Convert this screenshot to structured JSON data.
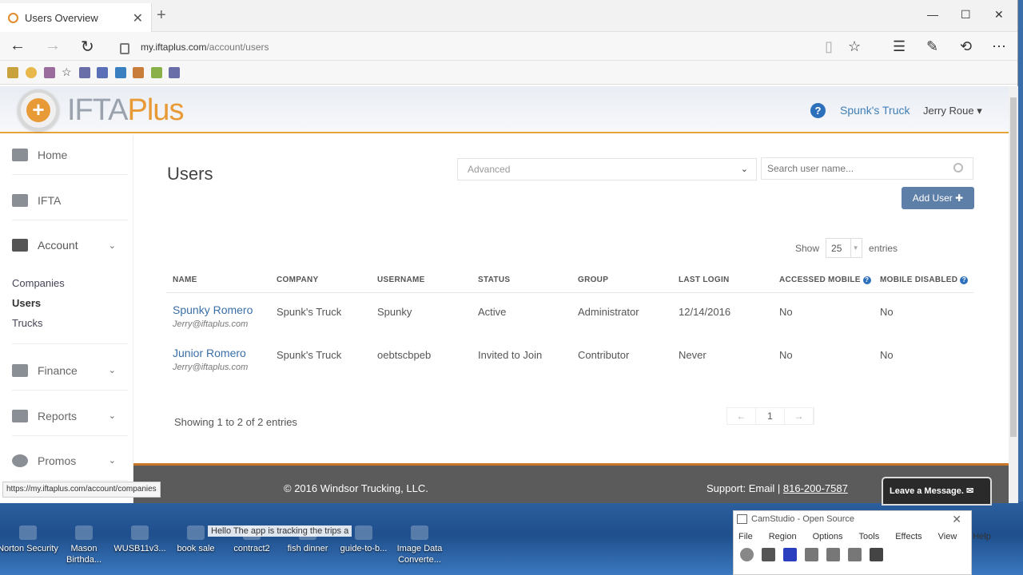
{
  "browser": {
    "tab_title": "Users Overview",
    "url_domain": "my.iftaplus.com",
    "url_path": "/account/users",
    "status_url": "https://my.iftaplus.com/account/companies"
  },
  "header": {
    "logo_ifta": "IFTA",
    "logo_plus": "Plus",
    "help": "?",
    "company": "Spunk's Truck",
    "user": "Jerry Roue ▾"
  },
  "sidebar": {
    "home": "Home",
    "ifta": "IFTA",
    "account": "Account",
    "sub": [
      "Companies",
      "Users",
      "Trucks"
    ],
    "finance": "Finance",
    "reports": "Reports",
    "promos": "Promos"
  },
  "main": {
    "title": "Users",
    "filter_placeholder": "Advanced",
    "search_placeholder": "Search user name...",
    "add_user": "Add User ✚",
    "show_label": "Show",
    "page_size": "25",
    "entries_label": "entries",
    "columns": [
      "NAME",
      "COMPANY",
      "USERNAME",
      "STATUS",
      "GROUP",
      "LAST LOGIN",
      "ACCESSED MOBILE",
      "MOBILE DISABLED"
    ],
    "rows": [
      {
        "name": "Spunky Romero",
        "email": "Jerry@iftaplus.com",
        "company": "Spunk's Truck",
        "username": "Spunky",
        "status": "Active",
        "group": "Administrator",
        "last_login": "12/14/2016",
        "accessed_mobile": "No",
        "mobile_disabled": "No"
      },
      {
        "name": "Junior Romero",
        "email": "Jerry@iftaplus.com",
        "company": "Spunk's Truck",
        "username": "oebtscbpeb",
        "status": "Invited to Join",
        "group": "Contributor",
        "last_login": "Never",
        "accessed_mobile": "No",
        "mobile_disabled": "No"
      }
    ],
    "info": "Showing 1 to 2 of 2 entries",
    "pager_prev": "←",
    "pager_current": "1",
    "pager_next": "→"
  },
  "footer": {
    "copyright": "© 2016 Windsor Trucking, LLC.",
    "support_label": "Support: Email |",
    "phone": "816-200-7587",
    "leave_message": "Leave a Message. ✉"
  },
  "desktop": {
    "icons": [
      "Norton Security",
      "Mason Birthda...",
      "WUSB11v3...",
      "book sale",
      "contract2",
      "fish dinner",
      "guide-to-b...",
      "Image Data Converte..."
    ],
    "note": "Hello The app is tracking the trips a"
  },
  "camstudio": {
    "title": "CamStudio - Open Source",
    "menu": [
      "File",
      "Region",
      "Options",
      "Tools",
      "Effects",
      "View",
      "Help"
    ]
  }
}
